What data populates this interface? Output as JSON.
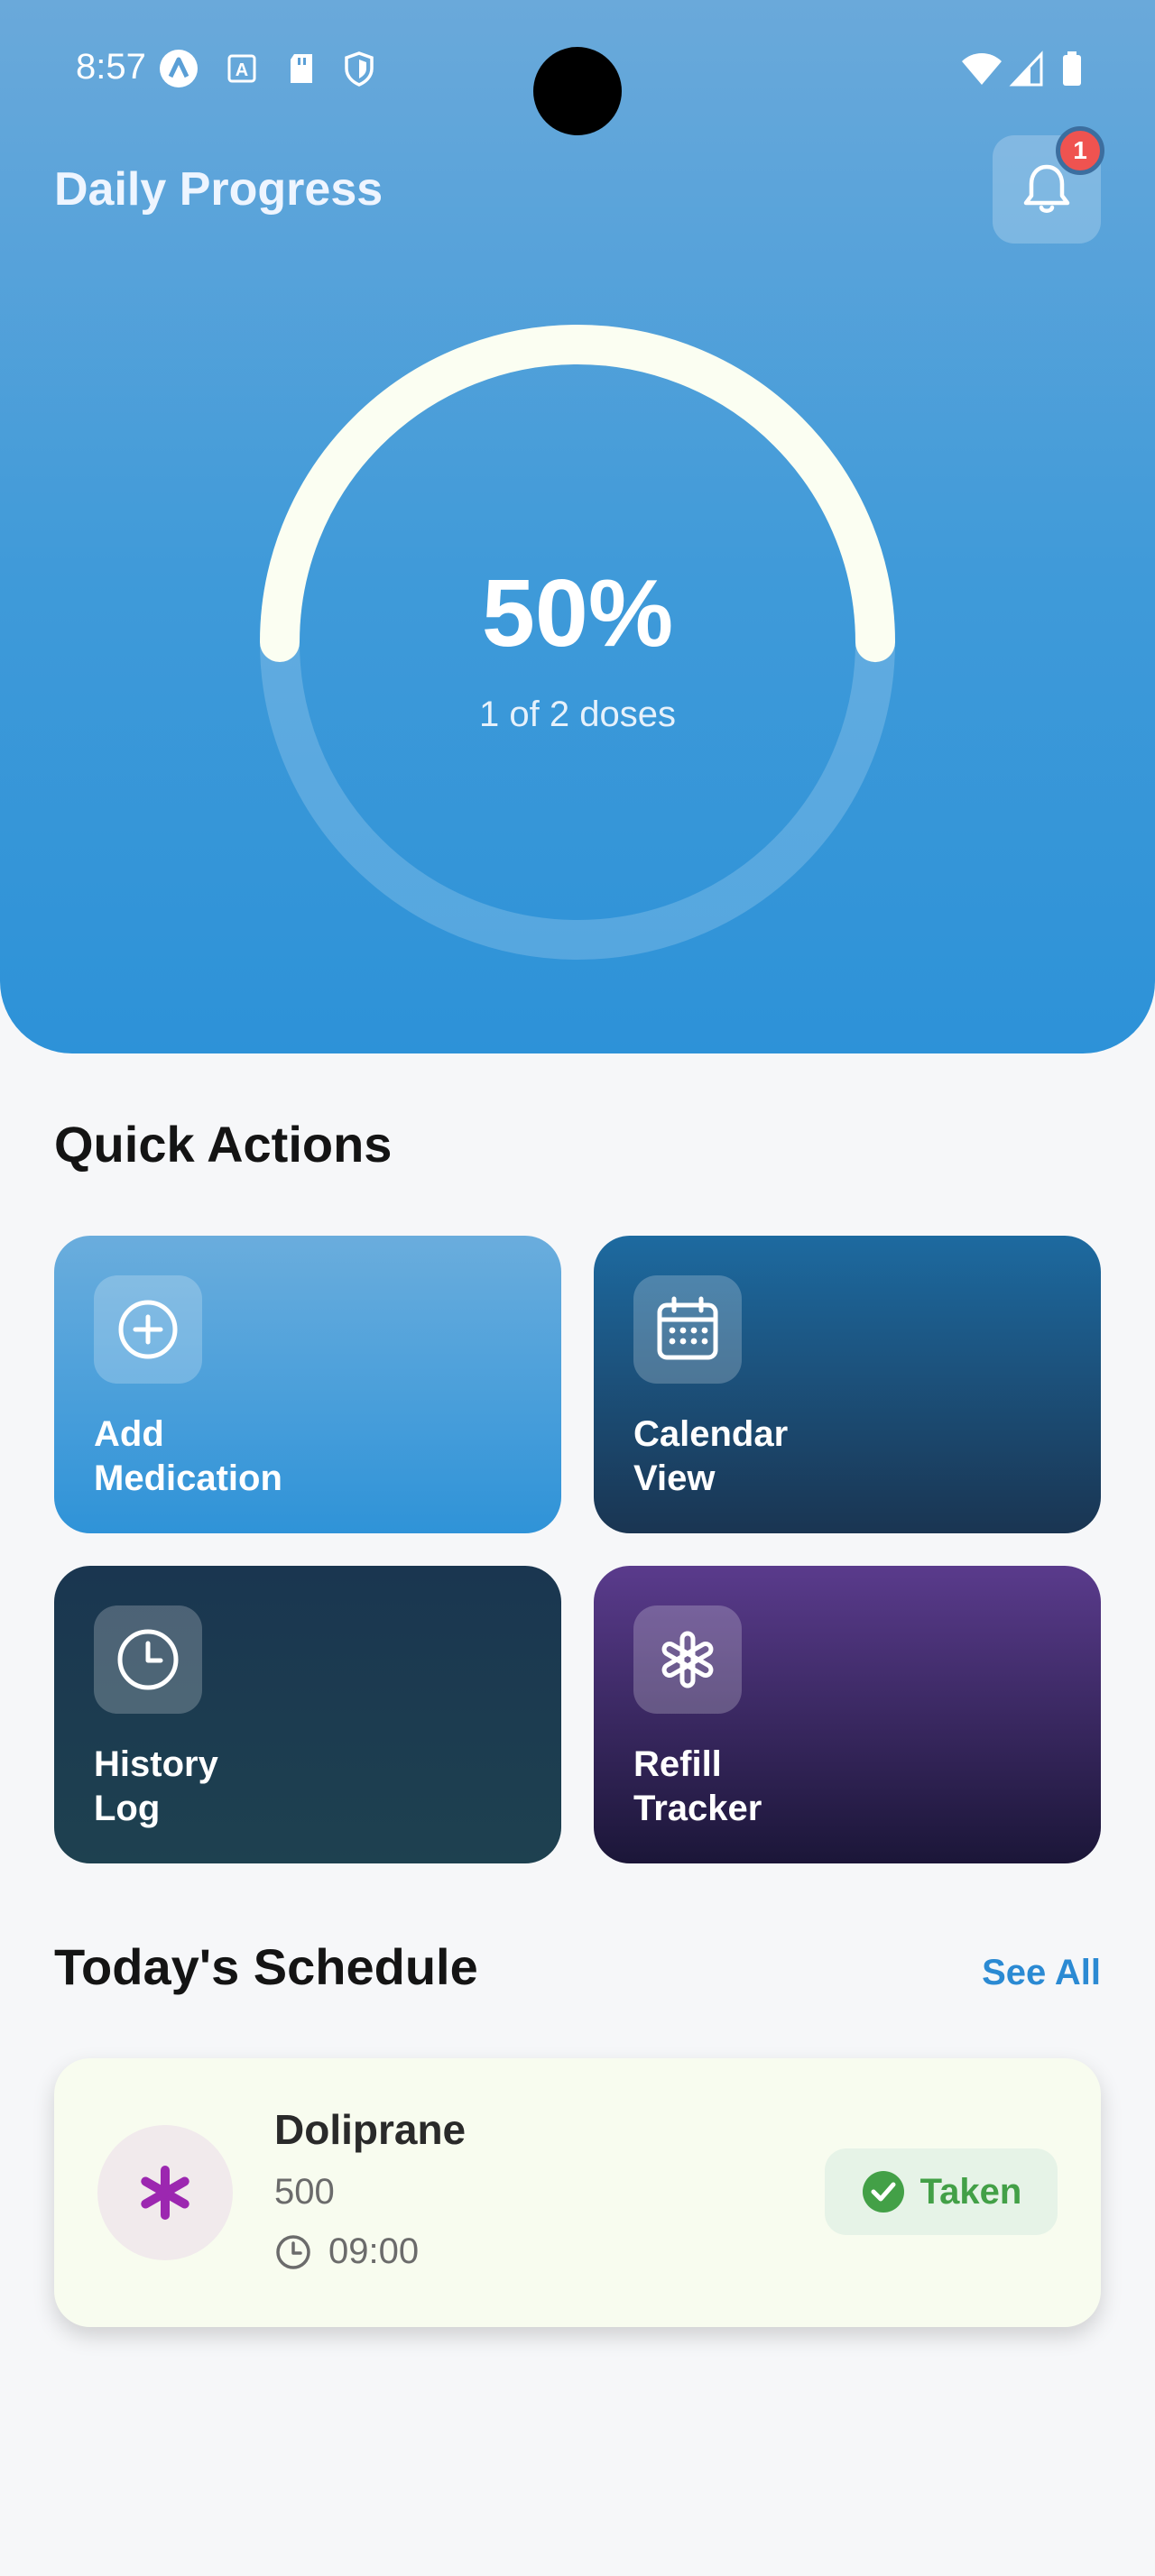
{
  "status_bar": {
    "time": "8:57",
    "icons": [
      "a-logo-icon",
      "a-accessibility-icon",
      "sd-card-icon",
      "shield-icon",
      "wifi-icon",
      "signal-icon",
      "battery-icon"
    ]
  },
  "header": {
    "title": "Daily Progress",
    "notification_count": "1",
    "progress": {
      "percent_label": "50%",
      "subtitle": "1 of 2 doses",
      "fraction": 0.5
    }
  },
  "quick_actions": {
    "title": "Quick Actions",
    "items": [
      {
        "label_line1": "Add",
        "label_line2": "Medication",
        "icon": "plus-circle-icon",
        "color": "#4a9fdc"
      },
      {
        "label_line1": "Calendar",
        "label_line2": "View",
        "icon": "calendar-icon",
        "color": "#1d4b72"
      },
      {
        "label_line1": "History",
        "label_line2": "Log",
        "icon": "clock-icon",
        "color": "#1c3d54"
      },
      {
        "label_line1": "Refill",
        "label_line2": "Tracker",
        "icon": "asterisk-icon",
        "color": "#3e2a6c"
      }
    ]
  },
  "schedule": {
    "title": "Today's Schedule",
    "see_all": "See All",
    "items": [
      {
        "name": "Doliprane",
        "dose": "500",
        "time": "09:00",
        "status": "Taken",
        "status_color": "#43a047",
        "icon_color": "#9c27b0"
      }
    ]
  }
}
